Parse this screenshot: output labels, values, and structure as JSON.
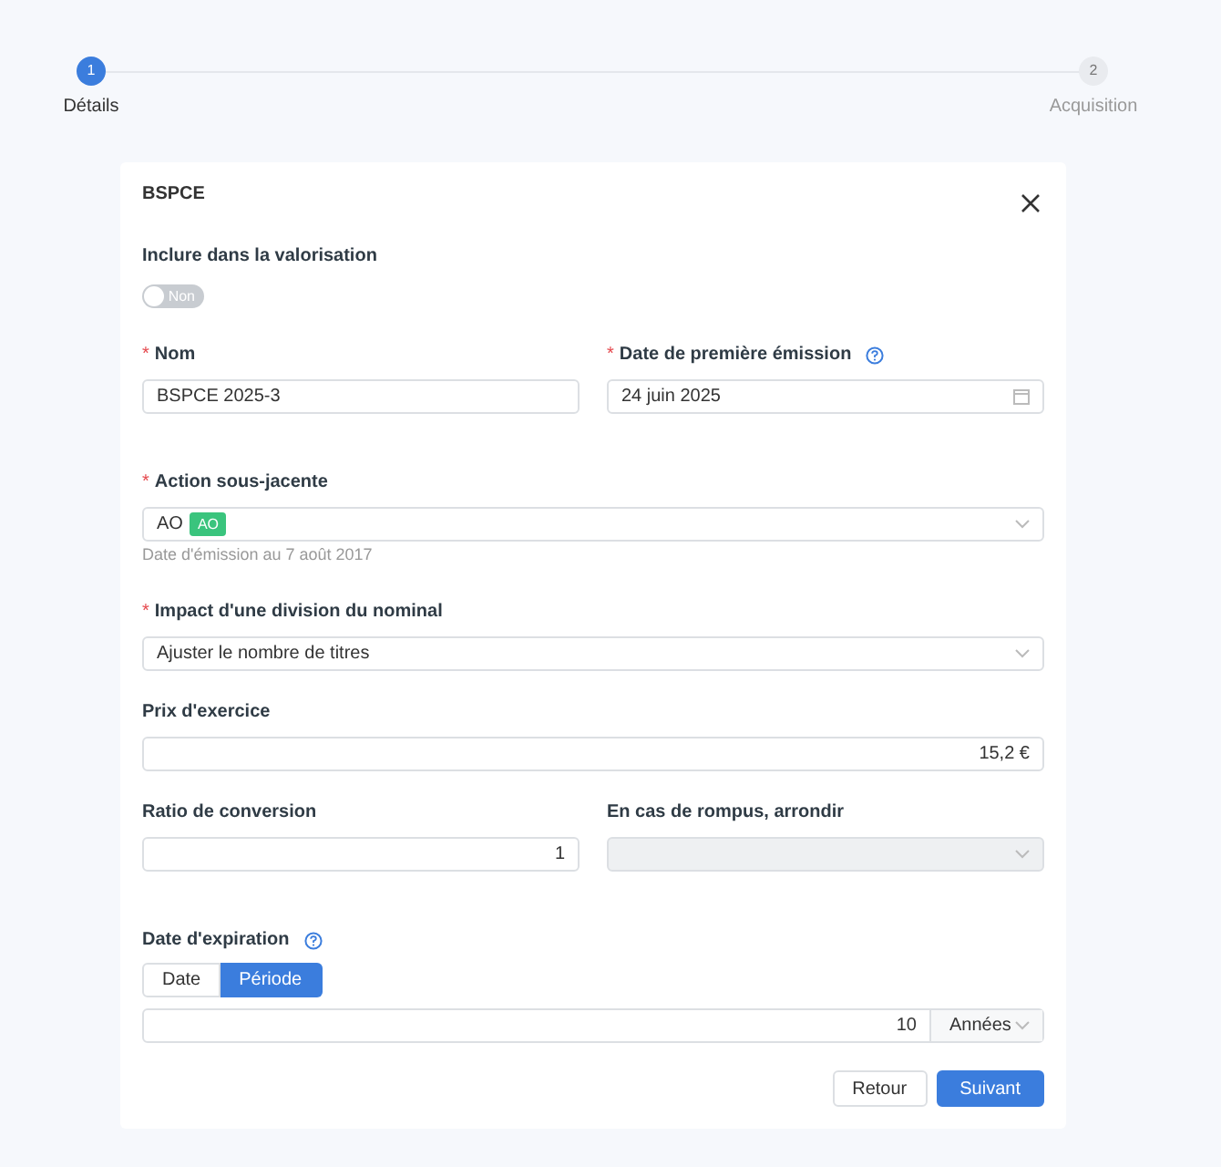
{
  "steps": [
    {
      "number": "1",
      "label": "Détails",
      "selected": true
    },
    {
      "number": "2",
      "label": "Acquisition",
      "selected": false
    }
  ],
  "card": {
    "title": "BSPCE",
    "valuation": {
      "label": "Inclure dans la valorisation",
      "on": false,
      "text": "Non"
    },
    "name": {
      "label": "Nom",
      "required_mark": "*",
      "value": "BSPCE 2025-3"
    },
    "issue_date": {
      "label": "Date de première émission",
      "required_mark": "*",
      "help": true,
      "value": "24 juin 2025"
    },
    "underlying": {
      "label": "Action sous-jacente",
      "required_mark": "*",
      "value": "AO",
      "tag": "AO",
      "hint": "Date d'émission au 7 août 2017"
    },
    "split_impact": {
      "label": "Impact d'une division du nominal",
      "required_mark": "*",
      "value": "Ajuster le nombre de titres"
    },
    "strike": {
      "label": "Prix d'exercice",
      "value": "15,2 €"
    },
    "ratio": {
      "label": "Ratio de conversion",
      "value": "1"
    },
    "rounding": {
      "label": "En cas de rompus, arrondir",
      "disabled": true
    },
    "expiration": {
      "label": "Date d'expiration",
      "help": true,
      "modes": [
        {
          "label": "Date",
          "selected": false
        },
        {
          "label": "Période",
          "selected": true
        }
      ],
      "value": "10",
      "unit": "Années"
    },
    "buttons": [
      {
        "label": "Retour",
        "kind": "secondary"
      },
      {
        "label": "Suivant",
        "kind": "primary"
      }
    ]
  }
}
